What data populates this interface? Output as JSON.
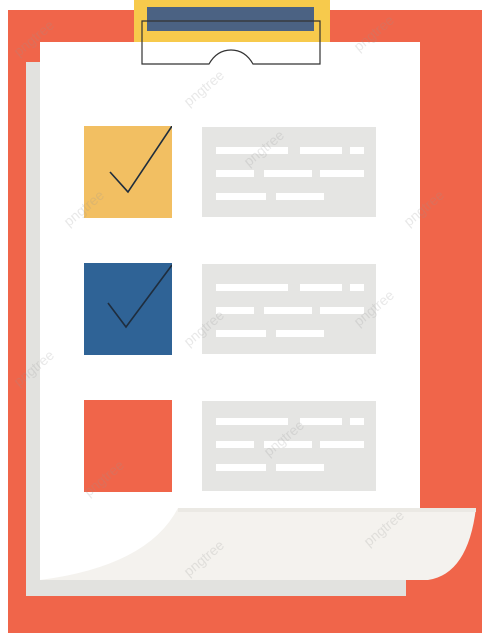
{
  "colors": {
    "board": "#f0654a",
    "sheet": "#ffffff",
    "clip": "#f7ca4c",
    "clip_bar": "#4b6283",
    "checkbox_1": "#f2bf62",
    "checkbox_2": "#2f6396",
    "checkbox_3": "#f0654a",
    "text_card": "#e5e5e3",
    "check_mark": "#1f2d3d"
  },
  "checklist": [
    {
      "checked": true
    },
    {
      "checked": true
    },
    {
      "checked": false
    }
  ],
  "watermark": {
    "text": "pngtree"
  }
}
